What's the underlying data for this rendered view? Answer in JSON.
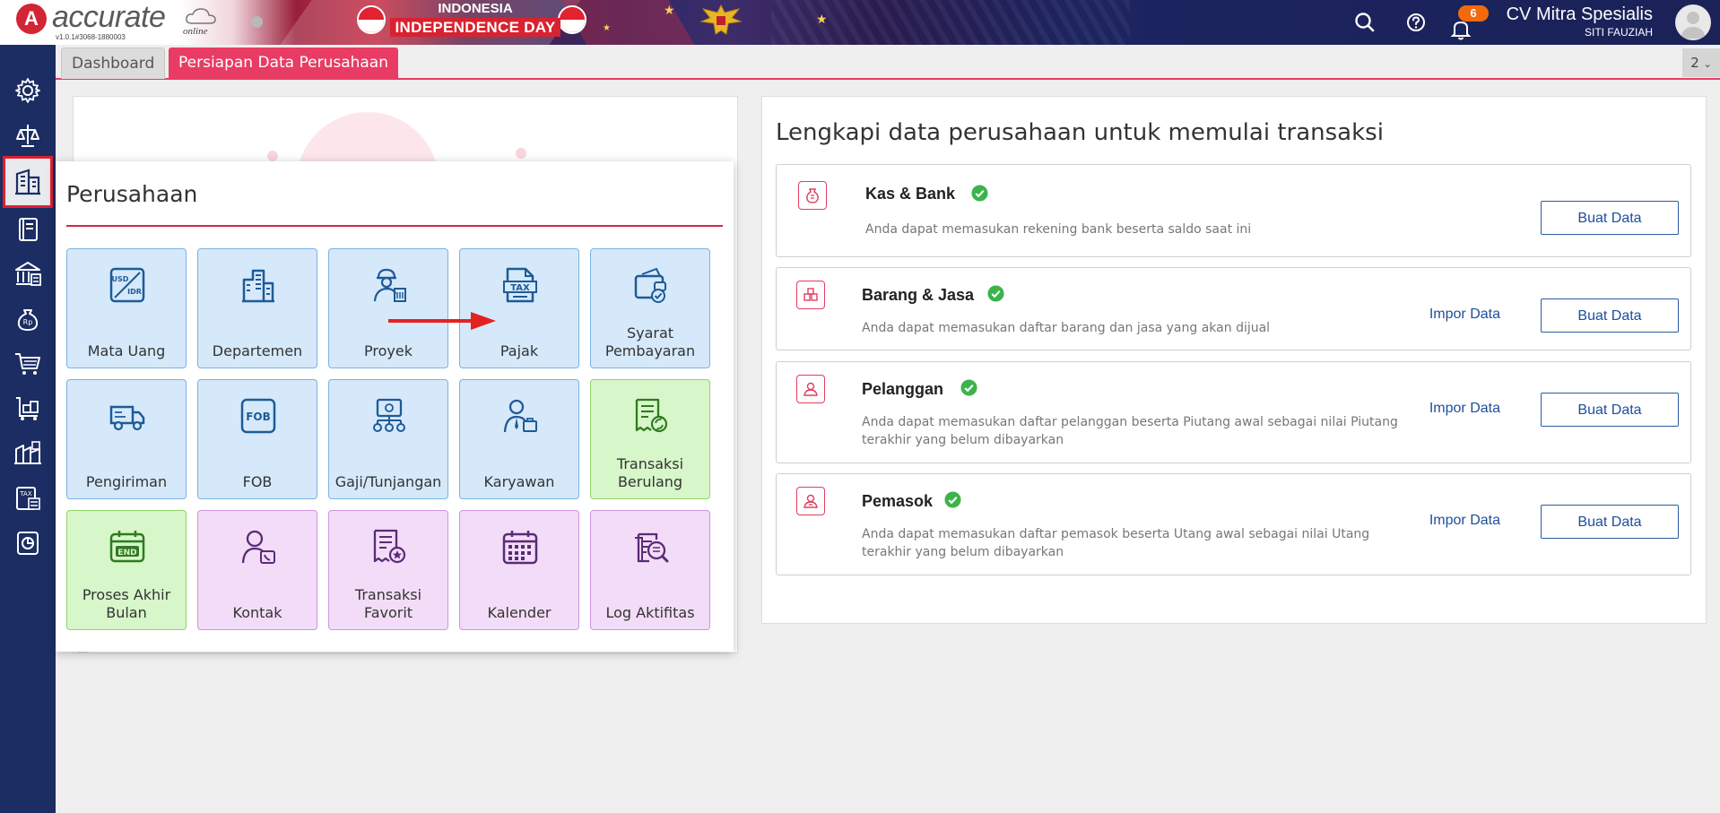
{
  "app": {
    "logo_text": "accurate",
    "logo_sub": "online",
    "version": "v1.0.1#3068-1880003",
    "banner_line1": "INDONESIA",
    "banner_line2": "INDEPENDENCE DAY"
  },
  "topbar": {
    "notification_count": "6",
    "company_name": "CV Mitra Spesialis",
    "user_name": "SITI FAUZIAH"
  },
  "tabs": [
    {
      "label": "Dashboard"
    },
    {
      "label": "Persiapan Data Perusahaan"
    }
  ],
  "tab_counter": "2",
  "sidebar": {
    "items": [
      {
        "icon": "gear-icon"
      },
      {
        "icon": "scale-icon"
      },
      {
        "icon": "building-icon"
      },
      {
        "icon": "ledger-icon"
      },
      {
        "icon": "bank-icon"
      },
      {
        "icon": "money-bag-icon"
      },
      {
        "icon": "cart-icon"
      },
      {
        "icon": "trolley-icon"
      },
      {
        "icon": "warehouse-icon"
      },
      {
        "icon": "tax-document-icon"
      },
      {
        "icon": "report-chart-icon"
      }
    ]
  },
  "popup": {
    "title": "Perusahaan",
    "tiles": [
      {
        "label": "Mata Uang",
        "icon": "currency-exchange-icon",
        "color": "blue"
      },
      {
        "label": "Departemen",
        "icon": "office-building-icon",
        "color": "blue"
      },
      {
        "label": "Proyek",
        "icon": "worker-project-icon",
        "color": "blue"
      },
      {
        "label": "Pajak",
        "icon": "tax-icon",
        "color": "blue"
      },
      {
        "label": "Syarat Pembayaran",
        "icon": "wallet-check-icon",
        "color": "blue"
      },
      {
        "label": "Pengiriman",
        "icon": "delivery-truck-icon",
        "color": "blue"
      },
      {
        "label": "FOB",
        "icon": "fob-icon",
        "color": "blue"
      },
      {
        "label": "Gaji/Tunjangan",
        "icon": "salary-structure-icon",
        "color": "blue"
      },
      {
        "label": "Karyawan",
        "icon": "employee-icon",
        "color": "blue"
      },
      {
        "label": "Transaksi Berulang",
        "icon": "recurring-receipt-icon",
        "color": "green"
      },
      {
        "label": "Proses Akhir Bulan",
        "icon": "end-of-month-calendar-icon",
        "color": "green"
      },
      {
        "label": "Kontak",
        "icon": "contact-phone-icon",
        "color": "purple"
      },
      {
        "label": "Transaksi Favorit",
        "icon": "favorite-receipt-icon",
        "color": "purple"
      },
      {
        "label": "Kalender",
        "icon": "calendar-icon",
        "color": "purple"
      },
      {
        "label": "Log Aktifitas",
        "icon": "activity-log-icon",
        "color": "purple"
      }
    ]
  },
  "main": {
    "title": "Lengkapi data perusahaan untuk memulai transaksi",
    "cards": [
      {
        "title": "Kas & Bank",
        "desc": "Anda dapat memasukan rekening bank beserta saldo saat ini",
        "import_label": "",
        "create_label": "Buat Data",
        "icon": "cash-bag-icon"
      },
      {
        "title": "Barang & Jasa",
        "desc": "Anda dapat memasukan daftar barang dan jasa yang akan dijual",
        "import_label": "Impor Data",
        "create_label": "Buat Data",
        "icon": "goods-boxes-icon"
      },
      {
        "title": "Pelanggan",
        "desc": "Anda dapat memasukan daftar pelanggan beserta Piutang awal sebagai nilai Piutang terakhir yang belum dibayarkan",
        "import_label": "Impor Data",
        "create_label": "Buat Data",
        "icon": "customer-icon"
      },
      {
        "title": "Pemasok",
        "desc": "Anda dapat memasukan daftar pemasok beserta Utang awal sebagai nilai Utang terakhir yang belum dibayarkan",
        "import_label": "Impor Data",
        "create_label": "Buat Data",
        "icon": "supplier-icon"
      }
    ]
  },
  "colors": {
    "accent": "#e83c64",
    "sidebar": "#1b2d63",
    "link": "#1d4e9c",
    "check": "#3cb44b",
    "tile_icon": "#1f5a96"
  }
}
